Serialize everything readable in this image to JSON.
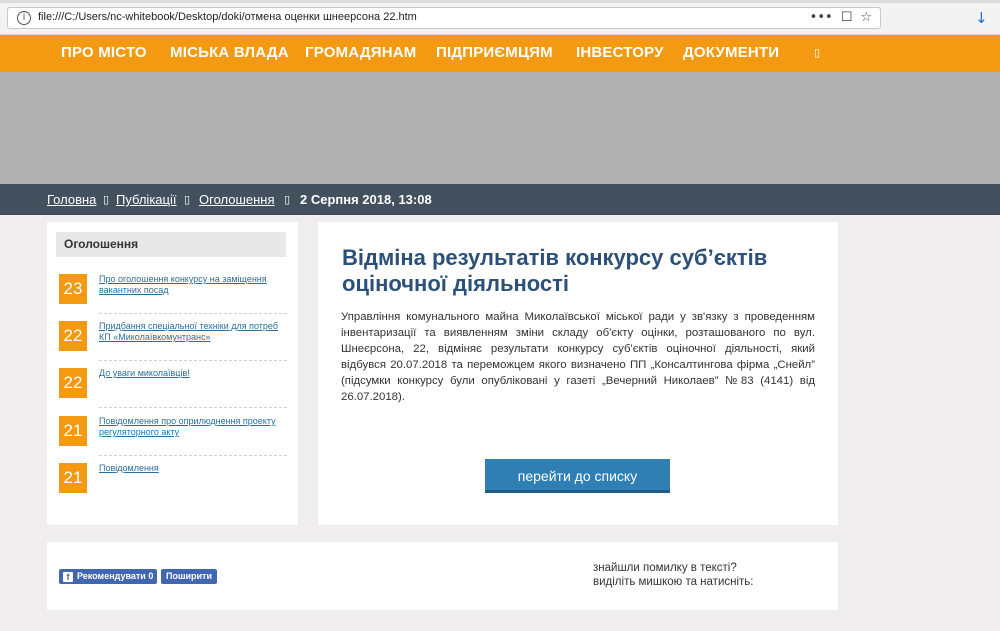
{
  "browser": {
    "url": "file:///C:/Users/nc-whitebook/Desktop/doki/отмена оценки шнеерсона 22.htm",
    "info_icon": "i",
    "menu_icon": "•••",
    "pocket_icon": "☐",
    "bookmark_icon": "☆",
    "download_icon": "↓"
  },
  "nav": {
    "items": [
      {
        "label": "Про місто"
      },
      {
        "label": "Міська влада"
      },
      {
        "label": "Громадянам"
      },
      {
        "label": "Підприємцям"
      },
      {
        "label": "Інвестору"
      },
      {
        "label": "Документи"
      }
    ],
    "extra_icon": "▯"
  },
  "breadcrumb": {
    "home": "Головна",
    "publications": "Публікації",
    "announcements": "Оголошення",
    "date": "2 Серпня 2018, 13:08",
    "separator": "▯"
  },
  "sidebar": {
    "title": "Оголошення",
    "items": [
      {
        "day": "23",
        "title": "Про оголошення конкурсу на заміщення вакантних посад"
      },
      {
        "day": "22",
        "title": "Придбання спеціальної техніки для потреб КП «Миколаївкомунтранс»"
      },
      {
        "day": "22",
        "title": "До уваги миколаївців!"
      },
      {
        "day": "21",
        "title": "Повідомлення про оприлюднення проекту регуляторного акту"
      },
      {
        "day": "21",
        "title": "Повідомлення"
      }
    ]
  },
  "article": {
    "title": "Відміна результатів конкурсу суб’єктів оціночної діяльності",
    "body": "Управління комунального майна Миколаївської міської ради у зв'язку з проведенням інвентаризації та виявленням зміни складу об'єкту оцінки, розташованого по вул. Шнеєрсона, 22, відміняє результати конкурсу суб'єктів оціночної діяльності, який відбувся 20.07.2018 та переможцем якого визначено ПП „Консалтингова фірма „Снейл” (підсумки конкурсу були опубліковані у газеті „Вечерний Николаев” №83 (4141) від 26.07.2018).",
    "back_button": "перейти до списку"
  },
  "footer": {
    "fb_like": "Рекомендувати",
    "fb_like_count": "0",
    "fb_icon": "f",
    "fb_share": "Поширити",
    "error_note_line1": "знайшли помилку в тексті?",
    "error_note_line2": "виділіть мишкою та натисніть:"
  },
  "colors": {
    "nav_bg": "#f39a12",
    "breadcrumb_bg": "#43505d",
    "title_color": "#2b5179",
    "button_bg": "#2f7fb4",
    "facebook": "#4267b2"
  }
}
